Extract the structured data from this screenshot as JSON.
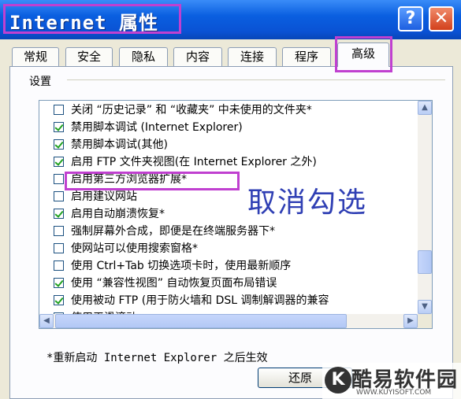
{
  "window": {
    "title": "Internet 属性",
    "help_label": "?",
    "close_label": "✕"
  },
  "tabs": [
    {
      "label": "常规"
    },
    {
      "label": "安全"
    },
    {
      "label": "隐私"
    },
    {
      "label": "内容"
    },
    {
      "label": "连接"
    },
    {
      "label": "程序"
    },
    {
      "label": "高级"
    }
  ],
  "active_tab": "高级",
  "settings": {
    "label": "设置",
    "items": [
      {
        "label": "关闭 “历史记录” 和 “收藏夹” 中未使用的文件夹*",
        "checked": false
      },
      {
        "label": "禁用脚本调试 (Internet Explorer)",
        "checked": true
      },
      {
        "label": "禁用脚本调试(其他)",
        "checked": true
      },
      {
        "label": "启用 FTP 文件夹视图(在 Internet Explorer 之外)",
        "checked": true
      },
      {
        "label": "启用第三方浏览器扩展*",
        "checked": false
      },
      {
        "label": "启用建议网站",
        "checked": false
      },
      {
        "label": "启用自动崩溃恢复*",
        "checked": true
      },
      {
        "label": "强制屏幕外合成，即便是在终端服务器下*",
        "checked": false
      },
      {
        "label": "使网站可以使用搜索窗格*",
        "checked": false
      },
      {
        "label": "使用 Ctrl+Tab 切换选项卡时，使用最新顺序",
        "checked": false
      },
      {
        "label": "使用 “兼容性视图” 自动恢复页面布局错误",
        "checked": true
      },
      {
        "label": "使用被动 FTP (用于防火墙和 DSL 调制解调器的兼容",
        "checked": true
      },
      {
        "label": "使用平滑滚动",
        "checked": true
      }
    ]
  },
  "annotation": "取消勾选",
  "note": "*重新启动 Internet Explorer 之后生效",
  "restore_button": "还原",
  "watermark": {
    "logo": "K",
    "text": "酷易软件园",
    "url": "WWW.KUYISOFT.COM"
  },
  "colors": {
    "titlebar": "#0a52d4",
    "highlight": "#c040d0",
    "annotation": "#2f3fb4",
    "check": "#21a121"
  },
  "icons": {
    "scroll_up": "▲",
    "scroll_down": "▼",
    "scroll_left": "◀",
    "scroll_right": "▶",
    "grip": "≡"
  }
}
